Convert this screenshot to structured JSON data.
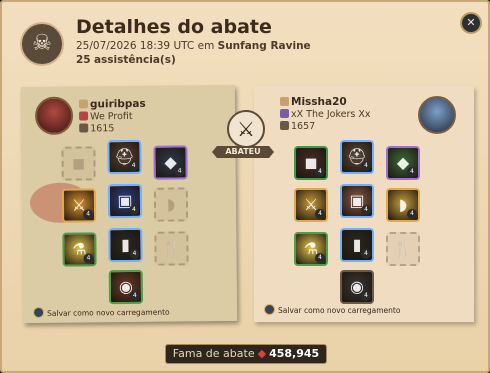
{
  "header": {
    "title": "Detalhes do abate",
    "datetime": "25/07/2026 18:39 UTC em",
    "location": "Sunfang Ravine",
    "assists_count": "25",
    "assists_label": "assistência(s)"
  },
  "killer": {
    "name": "guiribpas",
    "guild": "We Profit",
    "item_power": "1615",
    "save_label": "Salvar como novo carregamento",
    "equipment": [
      {
        "slot": "bag",
        "empty": true
      },
      {
        "slot": "head",
        "color": "#5a4032",
        "rarity": "#6fb0ff",
        "level": "4"
      },
      {
        "slot": "cape",
        "color": "#2f3a4a",
        "rarity": "#a070d0",
        "level": "4"
      },
      {
        "slot": "main-hand",
        "color": "#d9922d",
        "rarity": "#e4a74c",
        "level": "4"
      },
      {
        "slot": "chest",
        "color": "#2d3d82",
        "rarity": "#6fb0ff",
        "level": "4"
      },
      {
        "slot": "off-hand",
        "empty": true
      },
      {
        "slot": "potion",
        "color": "#e3c24a",
        "rarity": "#4da048",
        "level": "4"
      },
      {
        "slot": "shoes",
        "color": "#2a2620",
        "rarity": "#6fb0ff",
        "level": "4"
      },
      {
        "slot": "food",
        "empty": true
      },
      {
        "slot": "mount",
        "color": "#6a3c25",
        "rarity": "#4da048",
        "level": "4"
      }
    ]
  },
  "victim": {
    "name": "Missha20",
    "guild": "xX The Jokers Xx",
    "item_power": "1657",
    "save_label": "Salvar como novo carregamento",
    "equipment": [
      {
        "slot": "bag",
        "color": "#4a2d22",
        "rarity": "#3d9a4c",
        "level": "4"
      },
      {
        "slot": "head",
        "color": "#5b4a3b",
        "rarity": "#6fb0ff",
        "level": "4"
      },
      {
        "slot": "cape",
        "color": "#3d6b3a",
        "rarity": "#a070d0",
        "level": "4"
      },
      {
        "slot": "main-hand",
        "color": "#c99b3a",
        "rarity": "#e4a74c",
        "level": "4"
      },
      {
        "slot": "chest",
        "color": "#8a5a46",
        "rarity": "#6fb0ff",
        "level": "4"
      },
      {
        "slot": "off-hand",
        "color": "#c9a03a",
        "rarity": "#e4a74c",
        "level": "4"
      },
      {
        "slot": "potion",
        "color": "#e3c24a",
        "rarity": "#4da048",
        "level": "4"
      },
      {
        "slot": "shoes",
        "color": "#2a2620",
        "rarity": "#6fb0ff",
        "level": "4"
      },
      {
        "slot": "food",
        "empty": true
      },
      {
        "slot": "mount",
        "color": "#3a3532",
        "rarity": "#6a5a4a",
        "level": "4"
      }
    ]
  },
  "kill_label": "ABATEU",
  "fame": {
    "label": "Fama de abate",
    "value": "458,945"
  }
}
